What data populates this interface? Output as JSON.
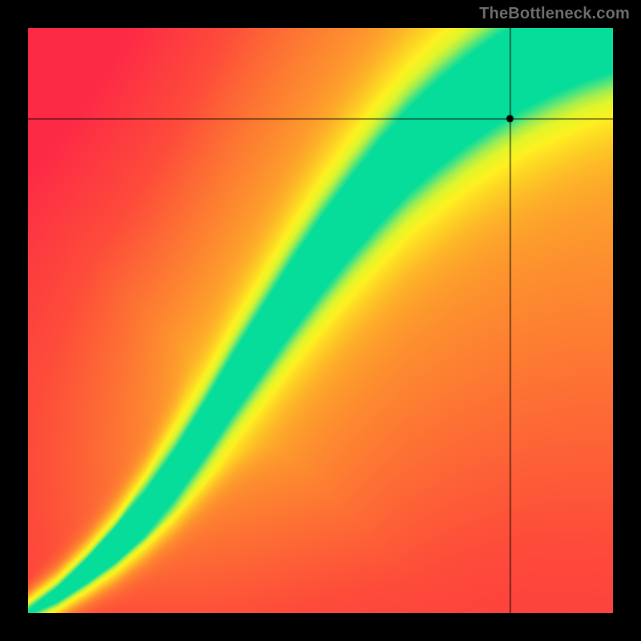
{
  "watermark": "TheBottleneck.com",
  "chart_data": {
    "type": "heatmap",
    "title": "",
    "xlabel": "",
    "ylabel": "",
    "x_range": [
      0,
      1
    ],
    "y_range": [
      0,
      1
    ],
    "crosshair": {
      "x": 0.825,
      "y": 0.845
    },
    "optimal_curve": {
      "description": "Green ridge maximum y as a function of x; straight with slight S ease at low x",
      "points": [
        [
          0.0,
          0.0
        ],
        [
          0.05,
          0.03
        ],
        [
          0.1,
          0.07
        ],
        [
          0.15,
          0.115
        ],
        [
          0.2,
          0.17
        ],
        [
          0.25,
          0.235
        ],
        [
          0.3,
          0.31
        ],
        [
          0.35,
          0.39
        ],
        [
          0.4,
          0.465
        ],
        [
          0.45,
          0.54
        ],
        [
          0.5,
          0.61
        ],
        [
          0.55,
          0.675
        ],
        [
          0.6,
          0.735
        ],
        [
          0.65,
          0.79
        ],
        [
          0.7,
          0.835
        ],
        [
          0.75,
          0.875
        ],
        [
          0.8,
          0.91
        ],
        [
          0.85,
          0.94
        ],
        [
          0.9,
          0.965
        ],
        [
          0.95,
          0.985
        ],
        [
          1.0,
          1.0
        ]
      ]
    },
    "ridge_width": {
      "description": "Visual green band half-width in y-units at sample x positions",
      "points": [
        [
          0.0,
          0.004
        ],
        [
          0.1,
          0.012
        ],
        [
          0.2,
          0.022
        ],
        [
          0.3,
          0.033
        ],
        [
          0.4,
          0.045
        ],
        [
          0.5,
          0.055
        ],
        [
          0.6,
          0.062
        ],
        [
          0.7,
          0.066
        ],
        [
          0.8,
          0.068
        ],
        [
          0.9,
          0.068
        ],
        [
          1.0,
          0.065
        ]
      ]
    },
    "colormap": {
      "description": "Piecewise stops; 0=worst(red) → 0.5(yellow) → 1=best(green)",
      "stops": [
        [
          0.0,
          "#fd2a46"
        ],
        [
          0.2,
          "#fd4b3a"
        ],
        [
          0.4,
          "#fd8b2f"
        ],
        [
          0.55,
          "#fdc326"
        ],
        [
          0.7,
          "#fef121"
        ],
        [
          0.8,
          "#e0f62b"
        ],
        [
          0.88,
          "#a0ed52"
        ],
        [
          0.94,
          "#4fe47e"
        ],
        [
          1.0,
          "#06dd9a"
        ]
      ]
    },
    "legend": false,
    "grid": false
  }
}
